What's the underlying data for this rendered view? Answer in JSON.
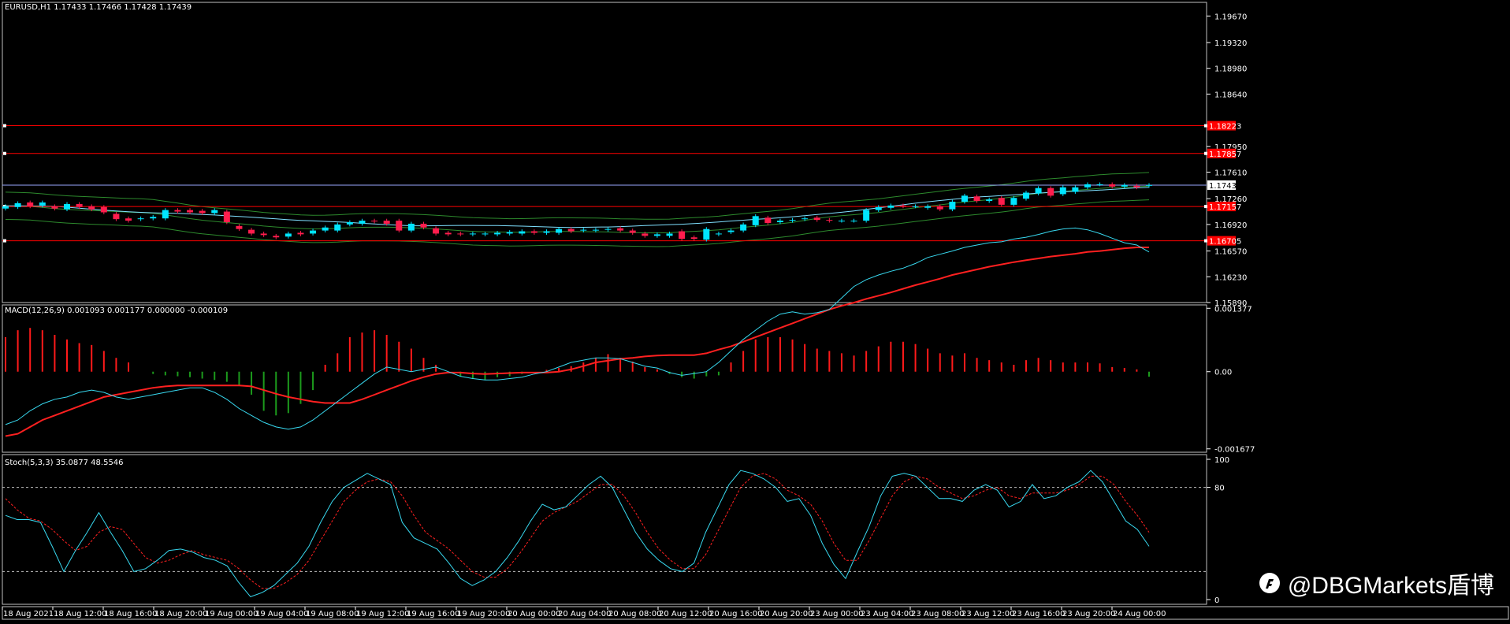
{
  "colors": {
    "bull": "#00e5ff",
    "bear": "#ff1d4d",
    "grid": "#888888",
    "hline": "#ff0000",
    "bands": "#2d8a2d",
    "ma": "#7fe0ff",
    "macd_main": "#ff2020",
    "macd_signal": "#38d9f0",
    "stoch_main": "#38d9f0",
    "stoch_signal": "#ff2020"
  },
  "main_header": "EURUSD,H1  1.17433 1.17466 1.17428 1.17439",
  "macd_header": "MACD(12,26,9) 0.001093 0.001177 0.000000 -0.000109",
  "stoch_header": "Stoch(5,3,3) 35.0877 48.5546",
  "watermark": "@DBGMarkets盾博",
  "price_ticks": [
    "1.19670",
    "1.19320",
    "1.18980",
    "1.18640",
    "1.17950",
    "1.17610",
    "1.17260",
    "1.16920",
    "1.16570",
    "1.16230",
    "1.15890"
  ],
  "price_tick_values": [
    1.1967,
    1.1932,
    1.1898,
    1.1864,
    1.1795,
    1.1761,
    1.1726,
    1.1692,
    1.1657,
    1.1623,
    1.1589
  ],
  "hlines": [
    {
      "label": "1.18223",
      "value": 1.18223
    },
    {
      "label": "1.17857",
      "value": 1.17857
    },
    {
      "label": "1.17157",
      "value": 1.17157
    },
    {
      "label": "1.16705",
      "value": 1.16705
    }
  ],
  "current_price": {
    "label": "1.17439",
    "value": 1.17439
  },
  "macd_ticks": [
    "0.001377",
    "0.00",
    "-0.001677"
  ],
  "macd_tick_values": [
    0.001377,
    0,
    -0.001677
  ],
  "stoch_ticks": [
    "100",
    "80",
    "0"
  ],
  "stoch_tick_values": [
    100,
    80,
    0
  ],
  "time_labels": [
    "18 Aug 2021",
    "18 Aug 12:00",
    "18 Aug 16:00",
    "18 Aug 20:00",
    "19 Aug 00:00",
    "19 Aug 04:00",
    "19 Aug 08:00",
    "19 Aug 12:00",
    "19 Aug 16:00",
    "19 Aug 20:00",
    "20 Aug 00:00",
    "20 Aug 04:00",
    "20 Aug 08:00",
    "20 Aug 12:00",
    "20 Aug 16:00",
    "20 Aug 20:00",
    "23 Aug 00:00",
    "23 Aug 04:00",
    "23 Aug 08:00",
    "23 Aug 12:00",
    "23 Aug 16:00",
    "23 Aug 20:00",
    "24 Aug 00:00"
  ],
  "chart_data": {
    "type": "candlestick",
    "symbol": "EURUSD",
    "timeframe": "H1",
    "ylim": [
      1.1589,
      1.1985
    ],
    "candles_oc": [
      [
        1.1713,
        1.1716
      ],
      [
        1.1715,
        1.172
      ],
      [
        1.1721,
        1.1716
      ],
      [
        1.1717,
        1.1721
      ],
      [
        1.1716,
        1.1713
      ],
      [
        1.1712,
        1.1719
      ],
      [
        1.1719,
        1.1715
      ],
      [
        1.1716,
        1.1712
      ],
      [
        1.1715,
        1.1708
      ],
      [
        1.1706,
        1.1699
      ],
      [
        1.17,
        1.1697
      ],
      [
        1.1699,
        1.17
      ],
      [
        1.17,
        1.1702
      ],
      [
        1.17,
        1.1711
      ],
      [
        1.1711,
        1.1709
      ],
      [
        1.1711,
        1.1708
      ],
      [
        1.171,
        1.1707
      ],
      [
        1.1707,
        1.1711
      ],
      [
        1.1709,
        1.1695
      ],
      [
        1.169,
        1.1686
      ],
      [
        1.1685,
        1.168
      ],
      [
        1.168,
        1.1678
      ],
      [
        1.1677,
        1.1675
      ],
      [
        1.1676,
        1.168
      ],
      [
        1.1681,
        1.1679
      ],
      [
        1.168,
        1.1684
      ],
      [
        1.1684,
        1.1688
      ],
      [
        1.1684,
        1.1692
      ],
      [
        1.1692,
        1.1695
      ],
      [
        1.1693,
        1.1697
      ],
      [
        1.1697,
        1.1696
      ],
      [
        1.1697,
        1.1693
      ],
      [
        1.1697,
        1.1684
      ],
      [
        1.1684,
        1.1693
      ],
      [
        1.1693,
        1.1688
      ],
      [
        1.1687,
        1.168
      ],
      [
        1.1681,
        1.1679
      ],
      [
        1.168,
        1.1679
      ],
      [
        1.1679,
        1.168
      ],
      [
        1.1679,
        1.168
      ],
      [
        1.1679,
        1.1681
      ],
      [
        1.168,
        1.1682
      ],
      [
        1.168,
        1.1683
      ],
      [
        1.1683,
        1.1681
      ],
      [
        1.1681,
        1.1683
      ],
      [
        1.1681,
        1.1686
      ],
      [
        1.1686,
        1.1683
      ],
      [
        1.1684,
        1.1685
      ],
      [
        1.1684,
        1.1685
      ],
      [
        1.1685,
        1.1686
      ],
      [
        1.1687,
        1.1684
      ],
      [
        1.1684,
        1.1681
      ],
      [
        1.168,
        1.1677
      ],
      [
        1.1677,
        1.1679
      ],
      [
        1.1677,
        1.168
      ],
      [
        1.1683,
        1.1673
      ],
      [
        1.1675,
        1.1673
      ],
      [
        1.1672,
        1.1686
      ],
      [
        1.1679,
        1.168
      ],
      [
        1.1682,
        1.1684
      ],
      [
        1.1684,
        1.1692
      ],
      [
        1.1691,
        1.1703
      ],
      [
        1.1701,
        1.1694
      ],
      [
        1.1695,
        1.1697
      ],
      [
        1.1697,
        1.1698
      ],
      [
        1.1699,
        1.17
      ],
      [
        1.1701,
        1.1698
      ],
      [
        1.1698,
        1.1697
      ],
      [
        1.1697,
        1.1697
      ],
      [
        1.1697,
        1.1697
      ],
      [
        1.1697,
        1.1711
      ],
      [
        1.1711,
        1.1715
      ],
      [
        1.1714,
        1.1717
      ],
      [
        1.1717,
        1.1716
      ],
      [
        1.1716,
        1.1716
      ],
      [
        1.1714,
        1.1716
      ],
      [
        1.1716,
        1.1712
      ],
      [
        1.1712,
        1.1722
      ],
      [
        1.1722,
        1.173
      ],
      [
        1.1729,
        1.1723
      ],
      [
        1.1723,
        1.1725
      ],
      [
        1.1727,
        1.1718
      ],
      [
        1.1718,
        1.1727
      ],
      [
        1.1726,
        1.1734
      ],
      [
        1.1733,
        1.174
      ],
      [
        1.174,
        1.173
      ],
      [
        1.1732,
        1.1741
      ],
      [
        1.1735,
        1.1741
      ],
      [
        1.1741,
        1.1745
      ],
      [
        1.1745,
        1.1745
      ],
      [
        1.1745,
        1.1742
      ],
      [
        1.1742,
        1.1744
      ],
      [
        1.1743,
        1.1741
      ],
      [
        1.1743,
        1.1744
      ]
    ],
    "series": [
      {
        "name": "MACD",
        "values": [
          0.00075,
          0.0009,
          0.00095,
          0.0009,
          0.0008,
          0.0007,
          0.00062,
          0.00058,
          0.00045,
          0.0003,
          0.0002,
          0.0,
          -5e-05,
          -8e-05,
          -0.0001,
          -0.00012,
          -0.00015,
          -0.00018,
          -0.00022,
          -0.0003,
          -0.0005,
          -0.00085,
          -0.00095,
          -0.0009,
          -0.0007,
          -0.0004,
          0.00015,
          0.0004,
          0.00075,
          0.00085,
          0.0009,
          0.0008,
          0.00065,
          0.0005,
          0.0003,
          0.00015,
          0.0,
          -0.0001,
          -0.00015,
          -0.00018,
          -0.00012,
          -0.0001,
          -5e-05,
          0.0,
          4e-05,
          8e-05,
          0.00012,
          0.0002,
          0.0003,
          0.00038,
          0.0003,
          0.00022,
          0.0001,
          5e-05,
          -5e-05,
          -0.00012,
          -0.00015,
          -0.0001,
          -8e-05,
          0.0002,
          0.00045,
          0.0007,
          0.00075,
          0.00075,
          0.0007,
          0.0006,
          0.0005,
          0.00045,
          0.0004,
          0.00035,
          0.00045,
          0.00055,
          0.00065,
          0.00065,
          0.0006,
          0.0005,
          0.0004,
          0.00035,
          0.0004,
          0.0003,
          0.00025,
          0.0002,
          0.00015,
          0.00025,
          0.0003,
          0.00025,
          0.0002,
          0.0002,
          0.0002,
          0.00018,
          0.0001,
          8e-05,
          5e-05,
          -0.00011
        ]
      },
      {
        "name": "Signal",
        "values": [
          -0.0014,
          -0.00135,
          -0.0012,
          -0.00105,
          -0.00095,
          -0.00085,
          -0.00075,
          -0.00065,
          -0.00055,
          -0.0005,
          -0.00045,
          -0.0004,
          -0.00035,
          -0.00032,
          -0.0003,
          -0.0003,
          -0.0003,
          -0.0003,
          -0.0003,
          -0.0003,
          -0.00032,
          -0.0004,
          -0.00048,
          -0.00055,
          -0.0006,
          -0.00065,
          -0.00068,
          -0.00068,
          -0.00068,
          -0.0006,
          -0.0005,
          -0.0004,
          -0.0003,
          -0.0002,
          -0.00012,
          -5e-05,
          -2e-05,
          -2e-05,
          -4e-05,
          -5e-05,
          -4e-05,
          -3e-05,
          -2e-05,
          -2e-05,
          -2e-05,
          0.0,
          5e-05,
          0.00012,
          0.0002,
          0.00024,
          0.00028,
          0.0003,
          0.00033,
          0.00035,
          0.00036,
          0.00036,
          0.00036,
          0.0004,
          0.00048,
          0.00055,
          0.00065,
          0.00075,
          0.00085,
          0.00095,
          0.00105,
          0.00115,
          0.00125,
          0.00135,
          0.00143,
          0.0015,
          0.00158,
          0.00165,
          0.00172,
          0.0018,
          0.00188,
          0.00195,
          0.00202,
          0.0021,
          0.00216,
          0.00222,
          0.00228,
          0.00233,
          0.00238,
          0.00242,
          0.00246,
          0.0025,
          0.00253,
          0.00256,
          0.0026,
          0.00262,
          0.00265,
          0.00268,
          0.0027,
          0.0027
        ]
      },
      {
        "name": "MACD line",
        "values": [
          -0.00115,
          -0.00105,
          -0.00085,
          -0.0007,
          -0.0006,
          -0.00055,
          -0.00045,
          -0.0004,
          -0.00045,
          -0.00055,
          -0.0006,
          -0.00055,
          -0.0005,
          -0.00045,
          -0.0004,
          -0.00035,
          -0.00035,
          -0.00045,
          -0.0006,
          -0.0008,
          -0.00095,
          -0.0011,
          -0.0012,
          -0.00125,
          -0.0012,
          -0.00105,
          -0.00085,
          -0.00065,
          -0.00045,
          -0.00025,
          -5e-05,
          0.0001,
          5e-05,
          0.0,
          5e-05,
          0.0001,
          0.0,
          -0.0001,
          -0.00015,
          -0.00018,
          -0.00018,
          -0.00015,
          -0.00012,
          -5e-05,
          0.0,
          0.0001,
          0.0002,
          0.00025,
          0.0003,
          0.0003,
          0.00028,
          0.0002,
          0.00012,
          8e-05,
          -2e-05,
          -8e-05,
          -4e-05,
          0.0,
          0.0002,
          0.00045,
          0.0007,
          0.0009,
          0.0011,
          0.00125,
          0.0013,
          0.00125,
          0.00128,
          0.00135,
          0.0016,
          0.00185,
          0.002,
          0.0021,
          0.00218,
          0.00225,
          0.00235,
          0.00248,
          0.00255,
          0.00262,
          0.0027,
          0.00275,
          0.0028,
          0.00282,
          0.00288,
          0.00292,
          0.00298,
          0.00305,
          0.0031,
          0.00312,
          0.00308,
          0.003,
          0.0029,
          0.0028,
          0.00275,
          0.0026
        ]
      },
      {
        "name": "Stoch main",
        "values": [
          60,
          57,
          57,
          55,
          38,
          20,
          35,
          48,
          62,
          48,
          35,
          20,
          22,
          28,
          35,
          36,
          34,
          30,
          28,
          24,
          12,
          2,
          5,
          10,
          18,
          26,
          38,
          55,
          70,
          80,
          85,
          90,
          86,
          82,
          55,
          44,
          40,
          36,
          26,
          15,
          10,
          14,
          20,
          30,
          42,
          56,
          68,
          64,
          66,
          74,
          82,
          88,
          80,
          64,
          48,
          36,
          28,
          22,
          20,
          26,
          48,
          65,
          82,
          92,
          90,
          86,
          80,
          70,
          72,
          60,
          40,
          25,
          15,
          34,
          52,
          74,
          88,
          90,
          88,
          80,
          72,
          72,
          70,
          78,
          82,
          78,
          66,
          70,
          82,
          72,
          74,
          80,
          84,
          92,
          84,
          70,
          56,
          50,
          38
        ]
      },
      {
        "name": "Stoch signal",
        "values": [
          72,
          64,
          58,
          56,
          50,
          42,
          35,
          38,
          48,
          52,
          50,
          40,
          30,
          26,
          28,
          32,
          35,
          32,
          30,
          28,
          22,
          14,
          8,
          8,
          12,
          18,
          28,
          42,
          56,
          70,
          78,
          84,
          86,
          84,
          74,
          60,
          48,
          42,
          36,
          28,
          20,
          16,
          16,
          22,
          32,
          44,
          56,
          62,
          66,
          70,
          76,
          82,
          82,
          74,
          62,
          48,
          36,
          28,
          22,
          22,
          32,
          48,
          64,
          80,
          88,
          90,
          86,
          78,
          74,
          68,
          56,
          40,
          28,
          28,
          42,
          58,
          74,
          84,
          88,
          86,
          80,
          76,
          72,
          74,
          78,
          80,
          74,
          72,
          76,
          76,
          76,
          78,
          82,
          88,
          88,
          82,
          70,
          60,
          48
        ]
      }
    ]
  }
}
